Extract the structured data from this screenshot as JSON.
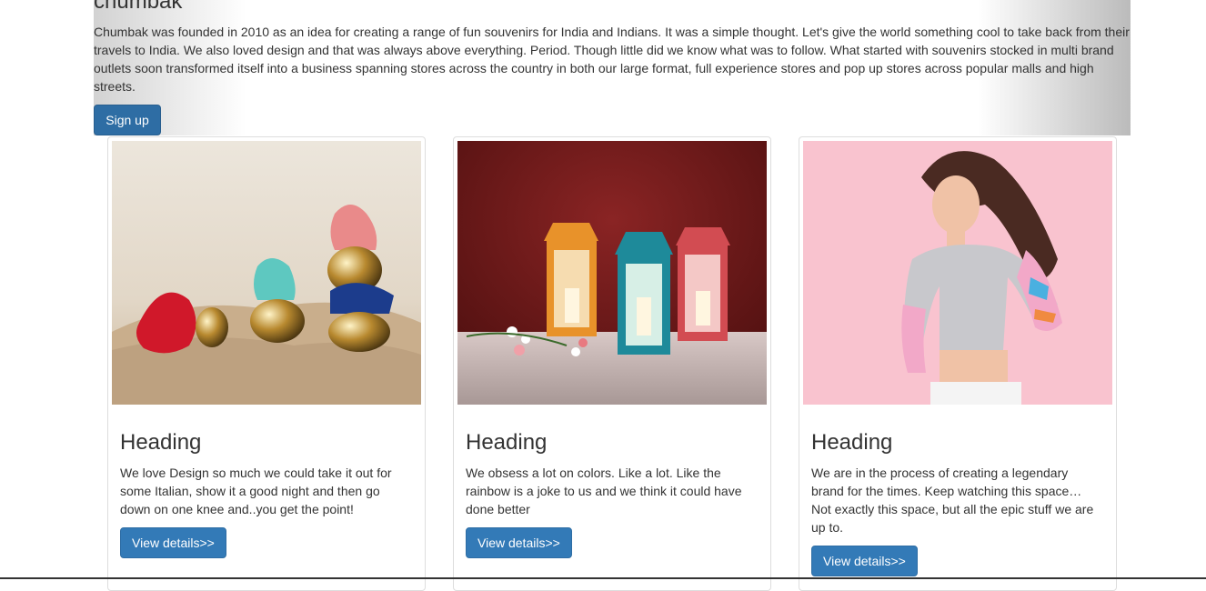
{
  "jumbotron": {
    "title": "chumbak",
    "intro": "Chumbak was founded in 2010 as an idea for creating a range of fun souvenirs for India and Indians. It was a simple thought. Let's give the world something cool to take back from their travels to India. We also loved design and that was always above everything. Period. Though little did we know what was to follow. What started with souvenirs stocked in multi brand outlets soon transformed itself into a business spanning stores across the country in both our large format, full experience stores and pop up stores across popular malls and high streets.",
    "signup_label": "Sign up"
  },
  "cards": [
    {
      "heading": "Heading",
      "text": "We love Design so much we could take it out for some Italian, show it a good night and then go down on one knee and..you get the point!",
      "button_label": "View details>>"
    },
    {
      "heading": "Heading",
      "text": "We obsess a lot on colors. Like a lot. Like the rainbow is a joke to us and we think it could have done better",
      "button_label": "View details>>"
    },
    {
      "heading": "Heading",
      "text": "We are in the process of creating a legendary brand for the times. Keep watching this space… Not exactly this space, but all the epic stuff we are up to.",
      "button_label": "View details>>"
    }
  ]
}
